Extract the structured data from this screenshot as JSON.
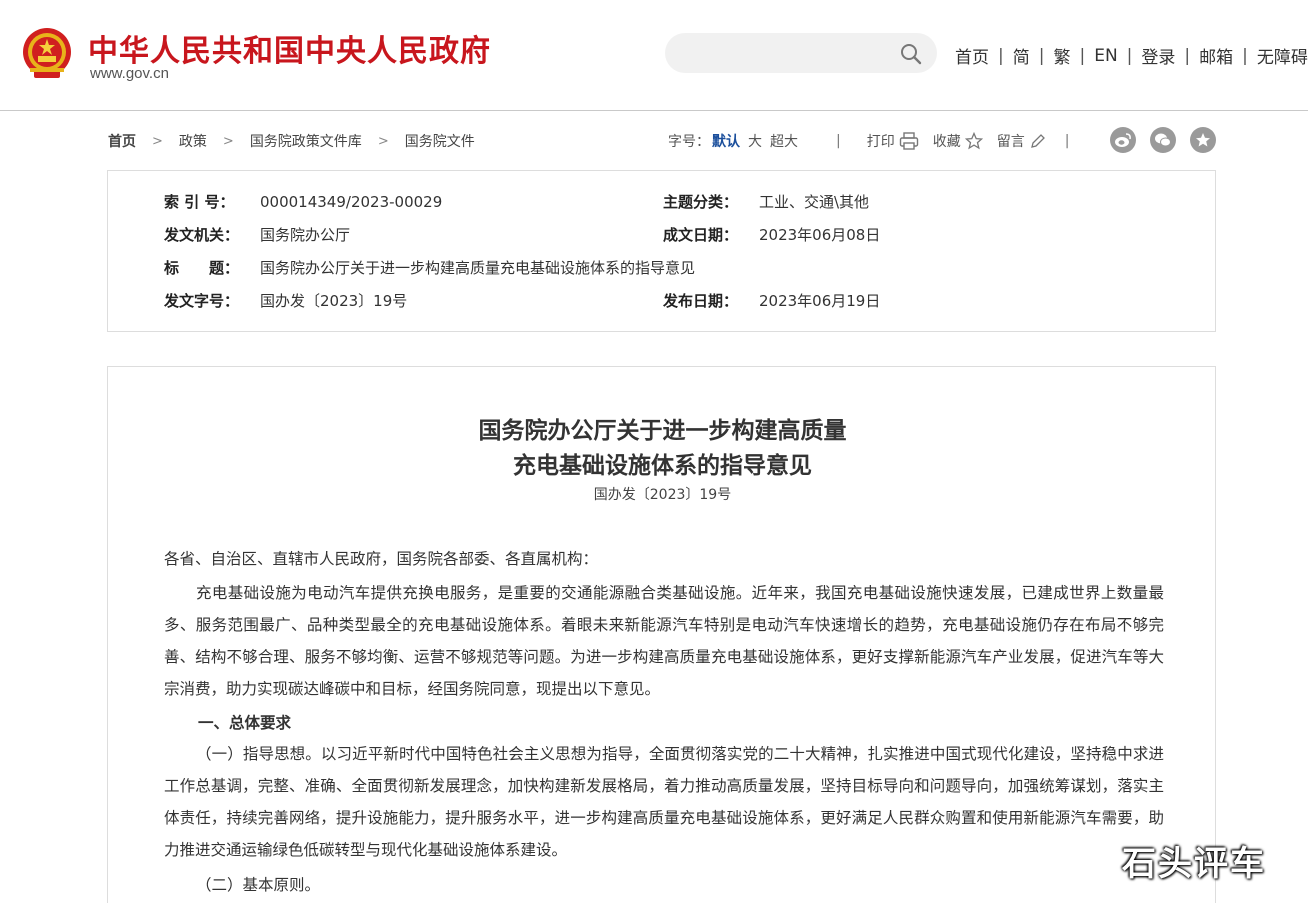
{
  "header": {
    "site_title": "中华人民共和国中央人民政府",
    "site_domain": "www.gov.cn",
    "nav": [
      "首页",
      "简",
      "繁",
      "EN",
      "登录",
      "邮箱",
      "无障碍"
    ]
  },
  "breadcrumb": [
    "首页",
    "政策",
    "国务院政策文件库",
    "国务院文件"
  ],
  "tools": {
    "font_label": "字号：",
    "font_sizes": [
      "默认",
      "大",
      "超大"
    ],
    "print": "打印",
    "favorite": "收藏",
    "comment": "留言"
  },
  "meta": {
    "index_no": {
      "label": "索 引 号：",
      "value": "000014349/2023-00029"
    },
    "category": {
      "label": "主题分类：",
      "value": "工业、交通\\其他"
    },
    "issuer": {
      "label": "发文机关：",
      "value": "国务院办公厅"
    },
    "written_date": {
      "label": "成文日期：",
      "value": "2023年06月08日"
    },
    "title": {
      "label": "标　　题：",
      "value": "国务院办公厅关于进一步构建高质量充电基础设施体系的指导意见"
    },
    "doc_no": {
      "label": "发文字号：",
      "value": "国办发〔2023〕19号"
    },
    "publish_date": {
      "label": "发布日期：",
      "value": "2023年06月19日"
    }
  },
  "article": {
    "title_line1": "国务院办公厅关于进一步构建高质量",
    "title_line2": "充电基础设施体系的指导意见",
    "doc_no": "国办发〔2023〕19号",
    "salutation": "各省、自治区、直辖市人民政府，国务院各部委、各直属机构：",
    "intro": "充电基础设施为电动汽车提供充换电服务，是重要的交通能源融合类基础设施。近年来，我国充电基础设施快速发展，已建成世界上数量最多、服务范围最广、品种类型最全的充电基础设施体系。着眼未来新能源汽车特别是电动汽车快速增长的趋势，充电基础设施仍存在布局不够完善、结构不够合理、服务不够均衡、运营不够规范等问题。为进一步构建高质量充电基础设施体系，更好支撑新能源汽车产业发展，促进汽车等大宗消费，助力实现碳达峰碳中和目标，经国务院同意，现提出以下意见。",
    "section1": "一、总体要求",
    "sub1": "（一）指导思想。以习近平新时代中国特色社会主义思想为指导，全面贯彻落实党的二十大精神，扎实推进中国式现代化建设，坚持稳中求进工作总基调，完整、准确、全面贯彻新发展理念，加快构建新发展格局，着力推动高质量发展，坚持目标导向和问题导向，加强统筹谋划，落实主体责任，持续完善网络，提升设施能力，提升服务水平，进一步构建高质量充电基础设施体系，更好满足人民群众购置和使用新能源汽车需要，助力推进交通运输绿色低碳转型与现代化基础设施体系建设。",
    "sub2": "（二）基本原则。"
  },
  "watermark": "石头评车",
  "colors": {
    "brand_red": "#c8161d",
    "link_blue": "#1b4f9c"
  }
}
